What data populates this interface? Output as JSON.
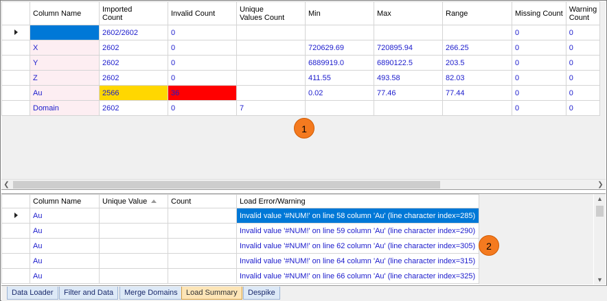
{
  "top_grid": {
    "headers": [
      "Column Name",
      "Imported\nCount",
      "Invalid Count",
      "Unique\nValues Count",
      "Min",
      "Max",
      "Range",
      "Missing Count",
      "Warning\nCount"
    ],
    "rows": [
      {
        "name": "",
        "imported": "2602/2602",
        "invalid": "0",
        "unique": "",
        "min": "",
        "max": "",
        "range": "",
        "missing": "0",
        "warning": "0"
      },
      {
        "name": "X",
        "imported": "2602",
        "invalid": "0",
        "unique": "",
        "min": "720629.69",
        "max": "720895.94",
        "range": "266.25",
        "missing": "0",
        "warning": "0"
      },
      {
        "name": "Y",
        "imported": "2602",
        "invalid": "0",
        "unique": "",
        "min": "6889919.0",
        "max": "6890122.5",
        "range": "203.5",
        "missing": "0",
        "warning": "0"
      },
      {
        "name": "Z",
        "imported": "2602",
        "invalid": "0",
        "unique": "",
        "min": "411.55",
        "max": "493.58",
        "range": "82.03",
        "missing": "0",
        "warning": "0"
      },
      {
        "name": "Au",
        "imported": "2566",
        "invalid": "36",
        "unique": "",
        "min": "0.02",
        "max": "77.46",
        "range": "77.44",
        "missing": "0",
        "warning": "0"
      },
      {
        "name": "Domain",
        "imported": "2602",
        "invalid": "0",
        "unique": "7",
        "min": "",
        "max": "",
        "range": "",
        "missing": "0",
        "warning": "0"
      }
    ]
  },
  "bottom_grid": {
    "headers": [
      "Column Name",
      "Unique Value",
      "Count",
      "Load Error/Warning"
    ],
    "rows": [
      {
        "name": "Au",
        "unique": "",
        "count": "",
        "message": "Invalid value '#NUM!' on line 58 column 'Au' (line character index=285)"
      },
      {
        "name": "Au",
        "unique": "",
        "count": "",
        "message": "Invalid value '#NUM!' on line 59 column 'Au' (line character index=290)"
      },
      {
        "name": "Au",
        "unique": "",
        "count": "",
        "message": "Invalid value '#NUM!' on line 62 column 'Au' (line character index=305)"
      },
      {
        "name": "Au",
        "unique": "",
        "count": "",
        "message": "Invalid value '#NUM!' on line 64 column 'Au' (line character index=315)"
      },
      {
        "name": "Au",
        "unique": "",
        "count": "",
        "message": "Invalid value '#NUM!' on line 66 column 'Au' (line character index=325)"
      }
    ]
  },
  "badges": {
    "one": "1",
    "two": "2"
  },
  "tabs": [
    "Data Loader",
    "Filter and Data",
    "Merge Domains",
    "Load Summary",
    "Despike"
  ],
  "active_tab": "Load Summary",
  "colors": {
    "selection": "#0078d7",
    "warning": "#ffd700",
    "error": "#ff0000",
    "badge": "#f47a1f",
    "value_text": "#1a1acc",
    "active_tab": "#fde5b7"
  },
  "icons": {
    "row_pointer": "row-pointer-icon",
    "sort": "sort-ascending-icon",
    "scroll_left": "scroll-left-icon",
    "scroll_right": "scroll-right-icon"
  }
}
